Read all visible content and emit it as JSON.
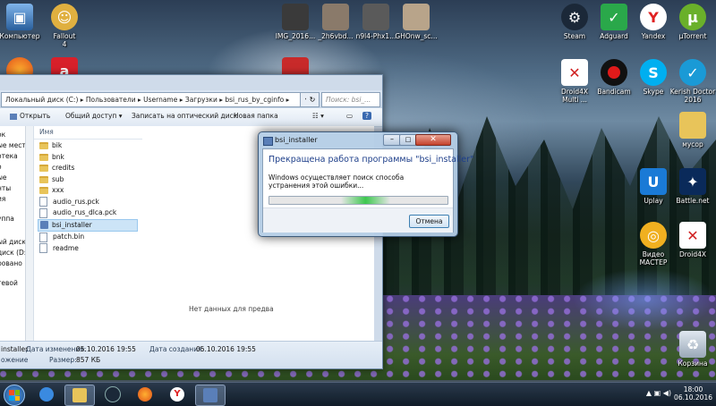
{
  "desktop_icons": {
    "computer": "Компьютер",
    "fallout": "Fallout\n4",
    "photo1": "IMG_2016...",
    "photo2": "_2h6vbd...",
    "photo3": "n9l4-Phx1...",
    "photo4": "GHOnw_sc...",
    "steam": "Steam",
    "adguard": "Adguard",
    "yandex": "Yandex",
    "utorrent": "µTorrent",
    "droid4x_multi": "Droid4X\nMulti ...",
    "bandicam": "Bandicam",
    "skype": "Skype",
    "kerish": "Kerish Doctor\n2016",
    "trash_folder": "мусор",
    "uplay": "Uplay",
    "battlenet": "Battle.net",
    "video_master": "Видео\nМАСТЕР",
    "droid4x": "Droid4X",
    "recycle_bin": "Корзина"
  },
  "explorer": {
    "address_path": "Локальный диск (C:)  ▸  Пользователи  ▸  Username  ▸  Загрузки  ▸  bsi_rus_by_cginfo  ▸",
    "search_placeholder": "Поиск: bsi_...",
    "toolbar": {
      "open": "Открыть",
      "share": "Общий доступ ▾",
      "burn": "Записать на оптический диск",
      "new_folder": "Новая папка"
    },
    "column_name": "Имя",
    "nav_items": [
      "ок",
      "ые места",
      "отека",
      "о",
      "ые",
      "нты",
      "ия",
      "уппа",
      "",
      "",
      "ый диск (",
      "диск (D:)",
      "ровано",
      "тевой"
    ],
    "files": [
      {
        "name": "bik",
        "type": "folder"
      },
      {
        "name": "bnk",
        "type": "folder"
      },
      {
        "name": "credits",
        "type": "folder"
      },
      {
        "name": "sub",
        "type": "folder"
      },
      {
        "name": "xxx",
        "type": "folder"
      },
      {
        "name": "audio_rus.pck",
        "type": "doc"
      },
      {
        "name": "audio_rus_dlca.pck",
        "type": "doc"
      },
      {
        "name": "bsi_installer",
        "type": "app"
      },
      {
        "name": "patch.bin",
        "type": "doc"
      },
      {
        "name": "readme",
        "type": "doc"
      }
    ],
    "empty_preview": "Нет данных для предва",
    "details": {
      "file_name": "installer",
      "file_type": "ожение",
      "modified_label": "Дата изменения:",
      "modified_value": "05.10.2016 19:55",
      "created_label": "Дата создания:",
      "created_value": "05.10.2016 19:55",
      "size_label": "Размер:",
      "size_value": "857 КБ"
    }
  },
  "dialog": {
    "title": "bsi_installer",
    "heading": "Прекращена работа программы \"bsi_installer\"",
    "message": "Windows осуществляет поиск способа устранения этой ошибки...",
    "cancel": "Отмена",
    "close_glyph": "✕",
    "min_glyph": "–",
    "max_glyph": "□"
  },
  "taskbar": {
    "time": "18:00",
    "date": "06.10.2016",
    "tray_icons": "▲  ▣  ◀)"
  },
  "colors": {
    "dialog_heading": "#1e3f8a",
    "progress_fill": "#3ec850"
  }
}
